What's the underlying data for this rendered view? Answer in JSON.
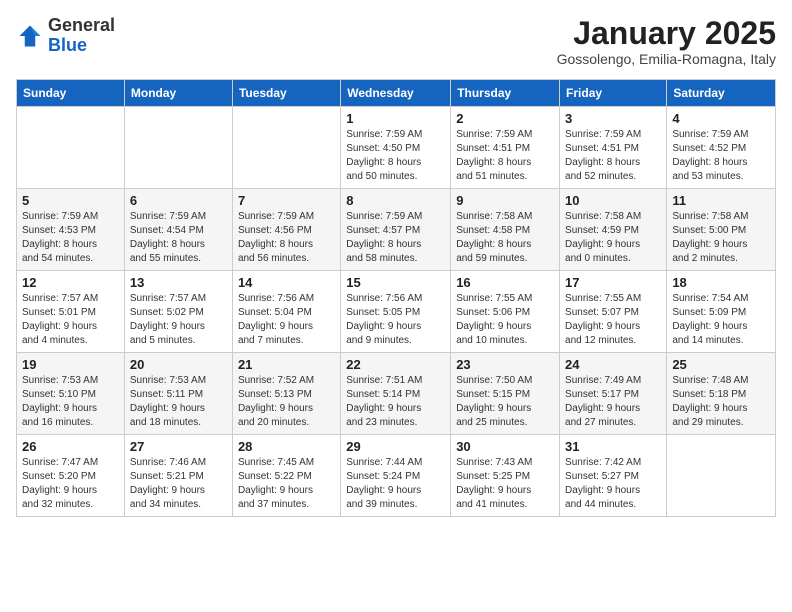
{
  "header": {
    "logo": {
      "general": "General",
      "blue": "Blue"
    },
    "title": "January 2025",
    "subtitle": "Gossolengo, Emilia-Romagna, Italy"
  },
  "days_of_week": [
    "Sunday",
    "Monday",
    "Tuesday",
    "Wednesday",
    "Thursday",
    "Friday",
    "Saturday"
  ],
  "weeks": [
    [
      {
        "day": "",
        "info": ""
      },
      {
        "day": "",
        "info": ""
      },
      {
        "day": "",
        "info": ""
      },
      {
        "day": "1",
        "info": "Sunrise: 7:59 AM\nSunset: 4:50 PM\nDaylight: 8 hours\nand 50 minutes."
      },
      {
        "day": "2",
        "info": "Sunrise: 7:59 AM\nSunset: 4:51 PM\nDaylight: 8 hours\nand 51 minutes."
      },
      {
        "day": "3",
        "info": "Sunrise: 7:59 AM\nSunset: 4:51 PM\nDaylight: 8 hours\nand 52 minutes."
      },
      {
        "day": "4",
        "info": "Sunrise: 7:59 AM\nSunset: 4:52 PM\nDaylight: 8 hours\nand 53 minutes."
      }
    ],
    [
      {
        "day": "5",
        "info": "Sunrise: 7:59 AM\nSunset: 4:53 PM\nDaylight: 8 hours\nand 54 minutes."
      },
      {
        "day": "6",
        "info": "Sunrise: 7:59 AM\nSunset: 4:54 PM\nDaylight: 8 hours\nand 55 minutes."
      },
      {
        "day": "7",
        "info": "Sunrise: 7:59 AM\nSunset: 4:56 PM\nDaylight: 8 hours\nand 56 minutes."
      },
      {
        "day": "8",
        "info": "Sunrise: 7:59 AM\nSunset: 4:57 PM\nDaylight: 8 hours\nand 58 minutes."
      },
      {
        "day": "9",
        "info": "Sunrise: 7:58 AM\nSunset: 4:58 PM\nDaylight: 8 hours\nand 59 minutes."
      },
      {
        "day": "10",
        "info": "Sunrise: 7:58 AM\nSunset: 4:59 PM\nDaylight: 9 hours\nand 0 minutes."
      },
      {
        "day": "11",
        "info": "Sunrise: 7:58 AM\nSunset: 5:00 PM\nDaylight: 9 hours\nand 2 minutes."
      }
    ],
    [
      {
        "day": "12",
        "info": "Sunrise: 7:57 AM\nSunset: 5:01 PM\nDaylight: 9 hours\nand 4 minutes."
      },
      {
        "day": "13",
        "info": "Sunrise: 7:57 AM\nSunset: 5:02 PM\nDaylight: 9 hours\nand 5 minutes."
      },
      {
        "day": "14",
        "info": "Sunrise: 7:56 AM\nSunset: 5:04 PM\nDaylight: 9 hours\nand 7 minutes."
      },
      {
        "day": "15",
        "info": "Sunrise: 7:56 AM\nSunset: 5:05 PM\nDaylight: 9 hours\nand 9 minutes."
      },
      {
        "day": "16",
        "info": "Sunrise: 7:55 AM\nSunset: 5:06 PM\nDaylight: 9 hours\nand 10 minutes."
      },
      {
        "day": "17",
        "info": "Sunrise: 7:55 AM\nSunset: 5:07 PM\nDaylight: 9 hours\nand 12 minutes."
      },
      {
        "day": "18",
        "info": "Sunrise: 7:54 AM\nSunset: 5:09 PM\nDaylight: 9 hours\nand 14 minutes."
      }
    ],
    [
      {
        "day": "19",
        "info": "Sunrise: 7:53 AM\nSunset: 5:10 PM\nDaylight: 9 hours\nand 16 minutes."
      },
      {
        "day": "20",
        "info": "Sunrise: 7:53 AM\nSunset: 5:11 PM\nDaylight: 9 hours\nand 18 minutes."
      },
      {
        "day": "21",
        "info": "Sunrise: 7:52 AM\nSunset: 5:13 PM\nDaylight: 9 hours\nand 20 minutes."
      },
      {
        "day": "22",
        "info": "Sunrise: 7:51 AM\nSunset: 5:14 PM\nDaylight: 9 hours\nand 23 minutes."
      },
      {
        "day": "23",
        "info": "Sunrise: 7:50 AM\nSunset: 5:15 PM\nDaylight: 9 hours\nand 25 minutes."
      },
      {
        "day": "24",
        "info": "Sunrise: 7:49 AM\nSunset: 5:17 PM\nDaylight: 9 hours\nand 27 minutes."
      },
      {
        "day": "25",
        "info": "Sunrise: 7:48 AM\nSunset: 5:18 PM\nDaylight: 9 hours\nand 29 minutes."
      }
    ],
    [
      {
        "day": "26",
        "info": "Sunrise: 7:47 AM\nSunset: 5:20 PM\nDaylight: 9 hours\nand 32 minutes."
      },
      {
        "day": "27",
        "info": "Sunrise: 7:46 AM\nSunset: 5:21 PM\nDaylight: 9 hours\nand 34 minutes."
      },
      {
        "day": "28",
        "info": "Sunrise: 7:45 AM\nSunset: 5:22 PM\nDaylight: 9 hours\nand 37 minutes."
      },
      {
        "day": "29",
        "info": "Sunrise: 7:44 AM\nSunset: 5:24 PM\nDaylight: 9 hours\nand 39 minutes."
      },
      {
        "day": "30",
        "info": "Sunrise: 7:43 AM\nSunset: 5:25 PM\nDaylight: 9 hours\nand 41 minutes."
      },
      {
        "day": "31",
        "info": "Sunrise: 7:42 AM\nSunset: 5:27 PM\nDaylight: 9 hours\nand 44 minutes."
      },
      {
        "day": "",
        "info": ""
      }
    ]
  ]
}
